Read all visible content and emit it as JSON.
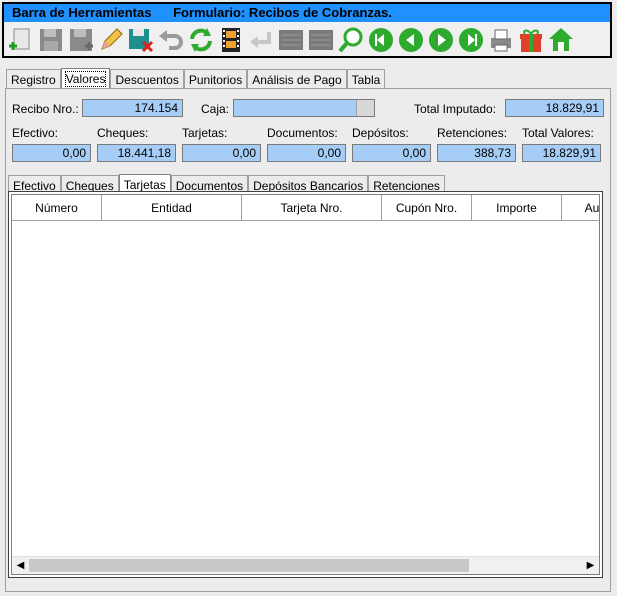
{
  "toolbar": {
    "title": "Barra de Herramientas",
    "form_title": "Formulario: Recibos de Cobranzas.",
    "buttons": [
      "new-icon",
      "save-icon",
      "save-new-icon",
      "edit-icon",
      "save-delete-icon",
      "undo-icon",
      "refresh-icon",
      "film-icon",
      "back-icon",
      "list-icon",
      "list2-icon",
      "search-icon",
      "first-icon",
      "prev-icon",
      "next-icon",
      "last-icon",
      "printer-icon",
      "gift-icon",
      "home-icon"
    ]
  },
  "main_tabs": [
    "Registro",
    "Valores",
    "Descuentos",
    "Punitorios",
    "Análisis de Pago",
    "Tabla"
  ],
  "main_tab_active": "Valores",
  "header": {
    "recibo_label": "Recibo Nro.:",
    "recibo_value": "174.154",
    "caja_label": "Caja:",
    "caja_value": "",
    "total_imputado_label": "Total Imputado:",
    "total_imputado_value": "18.829,91"
  },
  "totals": {
    "efectivo_label": "Efectivo:",
    "efectivo_value": "0,00",
    "cheques_label": "Cheques:",
    "cheques_value": "18.441,18",
    "tarjetas_label": "Tarjetas:",
    "tarjetas_value": "0,00",
    "documentos_label": "Documentos:",
    "documentos_value": "0,00",
    "depositos_label": "Depósitos:",
    "depositos_value": "0,00",
    "retenciones_label": "Retenciones:",
    "retenciones_value": "388,73",
    "total_valores_label": "Total Valores:",
    "total_valores_value": "18.829,91"
  },
  "sub_tabs": [
    "Efectivo",
    "Cheques",
    "Tarjetas",
    "Documentos",
    "Depósitos Bancarios",
    "Retenciones"
  ],
  "sub_tab_active": "Tarjetas",
  "grid": {
    "columns": [
      "Número",
      "Entidad",
      "Tarjeta Nro.",
      "Cupón Nro.",
      "Importe",
      "Au"
    ],
    "rows": []
  },
  "colors": {
    "title_bar": "#1e90ff",
    "field_bg": "#a6cdf5",
    "accent_green": "#2eaa2e"
  }
}
